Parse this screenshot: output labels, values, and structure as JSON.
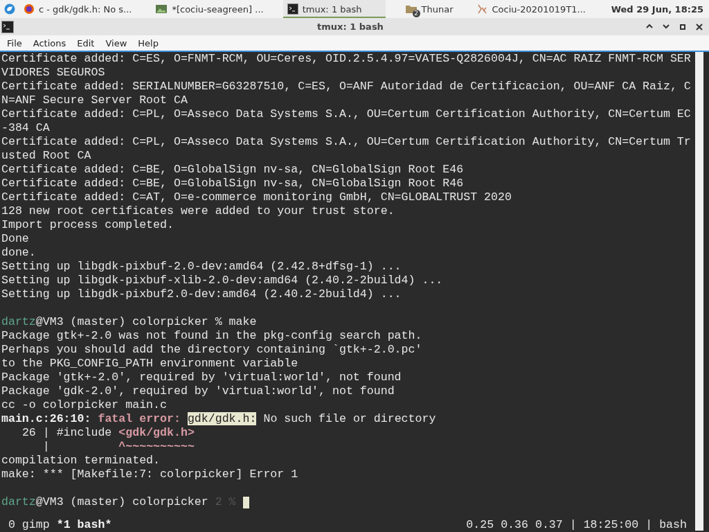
{
  "taskbar": {
    "tasks": [
      {
        "label": "c - gdk/gdk.h: No s...",
        "kind": "browser",
        "selected": false
      },
      {
        "label": "*[cociu-seagreen] ...",
        "kind": "image",
        "selected": false
      },
      {
        "label": "tmux: 1 bash",
        "kind": "terminal",
        "selected": true
      },
      {
        "label": "Thunar",
        "kind": "folder",
        "badge": "2",
        "selected": false
      },
      {
        "label": "Cociu-20201019T1...",
        "kind": "document",
        "selected": false
      }
    ],
    "clock": "Wed 29 Jun, 18:25"
  },
  "window": {
    "title": "tmux: 1 bash"
  },
  "menu": [
    "File",
    "Actions",
    "Edit",
    "View",
    "Help"
  ],
  "terminal": {
    "lines": [
      {
        "segments": [
          {
            "kind": "plain",
            "text": "Certificate added: C=ES, O=FNMT-RCM, OU=Ceres, OID.2.5.4.97=VATES-Q2826004J, CN=AC RAIZ FNMT-RCM SERVIDORES SEGUROS"
          }
        ]
      },
      {
        "segments": [
          {
            "kind": "plain",
            "text": "Certificate added: SERIALNUMBER=G63287510, C=ES, O=ANF Autoridad de Certificacion, OU=ANF CA Raiz, CN=ANF Secure Server Root CA"
          }
        ]
      },
      {
        "segments": [
          {
            "kind": "plain",
            "text": "Certificate added: C=PL, O=Asseco Data Systems S.A., OU=Certum Certification Authority, CN=Certum EC-384 CA"
          }
        ]
      },
      {
        "segments": [
          {
            "kind": "plain",
            "text": "Certificate added: C=PL, O=Asseco Data Systems S.A., OU=Certum Certification Authority, CN=Certum Trusted Root CA"
          }
        ]
      },
      {
        "segments": [
          {
            "kind": "plain",
            "text": "Certificate added: C=BE, O=GlobalSign nv-sa, CN=GlobalSign Root E46"
          }
        ]
      },
      {
        "segments": [
          {
            "kind": "plain",
            "text": "Certificate added: C=BE, O=GlobalSign nv-sa, CN=GlobalSign Root R46"
          }
        ]
      },
      {
        "segments": [
          {
            "kind": "plain",
            "text": "Certificate added: C=AT, O=e-commerce monitoring GmbH, CN=GLOBALTRUST 2020"
          }
        ]
      },
      {
        "segments": [
          {
            "kind": "plain",
            "text": "128 new root certificates were added to your trust store."
          }
        ]
      },
      {
        "segments": [
          {
            "kind": "plain",
            "text": "Import process completed."
          }
        ]
      },
      {
        "segments": [
          {
            "kind": "plain",
            "text": "Done"
          }
        ]
      },
      {
        "segments": [
          {
            "kind": "plain",
            "text": "done."
          }
        ]
      },
      {
        "segments": [
          {
            "kind": "plain",
            "text": "Setting up libgdk-pixbuf-2.0-dev:amd64 (2.42.8+dfsg-1) ..."
          }
        ]
      },
      {
        "segments": [
          {
            "kind": "plain",
            "text": "Setting up libgdk-pixbuf-xlib-2.0-dev:amd64 (2.40.2-2build4) ..."
          }
        ]
      },
      {
        "segments": [
          {
            "kind": "plain",
            "text": "Setting up libgdk-pixbuf2.0-dev:amd64 (2.40.2-2build4) ..."
          }
        ]
      },
      {
        "blank_before": true,
        "segments": [
          {
            "kind": "user",
            "text": "dartz"
          },
          {
            "kind": "plain",
            "text": "@VM3 (master) colorpicker % make"
          }
        ]
      },
      {
        "segments": [
          {
            "kind": "plain",
            "text": "Package gtk+-2.0 was not found in the pkg-config search path."
          }
        ]
      },
      {
        "segments": [
          {
            "kind": "plain",
            "text": "Perhaps you should add the directory containing `gtk+-2.0.pc'"
          }
        ]
      },
      {
        "segments": [
          {
            "kind": "plain",
            "text": "to the PKG_CONFIG_PATH environment variable"
          }
        ]
      },
      {
        "segments": [
          {
            "kind": "plain",
            "text": "Package 'gtk+-2.0', required by 'virtual:world', not found"
          }
        ]
      },
      {
        "segments": [
          {
            "kind": "plain",
            "text": "Package 'gdk-2.0', required by 'virtual:world', not found"
          }
        ]
      },
      {
        "segments": [
          {
            "kind": "plain",
            "text": "cc -o colorpicker main.c"
          }
        ]
      },
      {
        "segments": [
          {
            "kind": "bold",
            "text": "main.c:26:10: "
          },
          {
            "kind": "error",
            "text": "fatal error: "
          },
          {
            "kind": "highlight",
            "text": "gdk/gdk.h:"
          },
          {
            "kind": "plain",
            "text": " No such file or directory"
          }
        ]
      },
      {
        "segments": [
          {
            "kind": "plain",
            "text": "   26 | #include "
          },
          {
            "kind": "error",
            "text": "<gdk/gdk.h>"
          }
        ]
      },
      {
        "segments": [
          {
            "kind": "plain",
            "text": "      |          "
          },
          {
            "kind": "error",
            "text": "^~~~~~~~~~~"
          }
        ]
      },
      {
        "segments": [
          {
            "kind": "plain",
            "text": "compilation terminated."
          }
        ]
      },
      {
        "segments": [
          {
            "kind": "plain",
            "text": "make: *** [Makefile:7: colorpicker] Error 1"
          }
        ]
      },
      {
        "blank_before": true,
        "segments": [
          {
            "kind": "user",
            "text": "dartz"
          },
          {
            "kind": "plain",
            "text": "@VM3 (master) colorpicker "
          },
          {
            "kind": "dim",
            "text": "2 %"
          }
        ],
        "cursor": true
      }
    ]
  },
  "status_bar": {
    "left": [
      {
        "kind": "plain",
        "text": " 0 gimp "
      },
      {
        "kind": "bold",
        "text": "*1 bash*"
      }
    ],
    "right": "0.25 0.36 0.37 | 18:25:00 | bash"
  }
}
